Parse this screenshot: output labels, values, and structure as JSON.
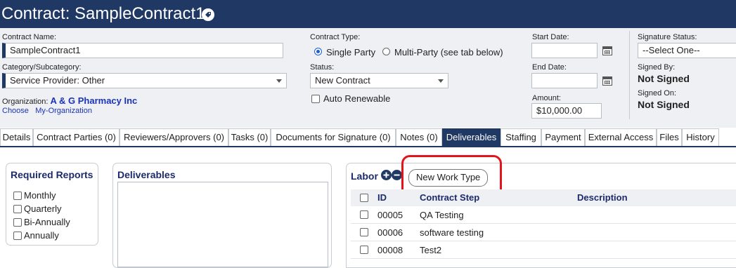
{
  "header": {
    "title": "Contract: SampleContract1",
    "icon": "tag-icon",
    "bg_color": "#1f3864"
  },
  "form": {
    "contract_name": {
      "label": "Contract Name:",
      "value": "SampleContract1"
    },
    "category": {
      "label": "Category/Subcategory:",
      "value": "Service Provider: Other"
    },
    "organization": {
      "label": "Organization:",
      "value": "A & G Pharmacy Inc",
      "choose_link": "Choose",
      "my_org_link": "My-Organization"
    },
    "contract_type": {
      "label": "Contract Type:",
      "options": [
        "Single Party",
        "Multi-Party (see tab below)"
      ],
      "selected": "Single Party"
    },
    "status": {
      "label": "Status:",
      "value": "New Contract"
    },
    "auto_renewable": {
      "label": "Auto Renewable",
      "checked": false
    },
    "start_date": {
      "label": "Start Date:",
      "value": ""
    },
    "end_date": {
      "label": "End Date:",
      "value": ""
    },
    "amount": {
      "label": "Amount:",
      "value": "$10,000.00"
    },
    "signature_status": {
      "label": "Signature Status:",
      "value": "--Select One--"
    },
    "signed_by": {
      "label": "Signed By:",
      "value": "Not Signed"
    },
    "signed_on": {
      "label": "Signed On:",
      "value": "Not Signed"
    }
  },
  "tabs": [
    {
      "label": "Details"
    },
    {
      "label": "Contract Parties (0)"
    },
    {
      "label": "Reviewers/Approvers (0)"
    },
    {
      "label": "Tasks (0)"
    },
    {
      "label": "Documents for Signature (0)"
    },
    {
      "label": "Notes (0)"
    },
    {
      "label": "Deliverables",
      "active": true
    },
    {
      "label": "Staffing"
    },
    {
      "label": "Payment"
    },
    {
      "label": "External Access"
    },
    {
      "label": "Files"
    },
    {
      "label": "History"
    }
  ],
  "required_reports": {
    "title": "Required Reports",
    "items": [
      "Monthly",
      "Quarterly",
      "Bi-Annually",
      "Annually"
    ]
  },
  "deliverables": {
    "title": "Deliverables"
  },
  "labor": {
    "title": "Labor",
    "new_work_type_button": "New Work Type",
    "columns": {
      "id": "ID",
      "step": "Contract Step",
      "description": "Description"
    },
    "rows": [
      {
        "id": "00005",
        "step": "QA Testing",
        "description": ""
      },
      {
        "id": "00006",
        "step": "software testing",
        "description": ""
      },
      {
        "id": "00008",
        "step": "Test2",
        "description": ""
      }
    ]
  },
  "colors": {
    "accent": "#1f3864",
    "link": "#1a33b8",
    "highlight": "#e3141b"
  }
}
